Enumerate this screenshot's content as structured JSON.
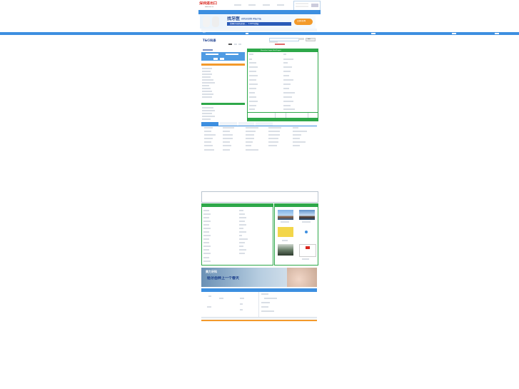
{
  "site": {
    "logo_cn": "深圳进出口",
    "logo_url": "www.szie.cn"
  },
  "top_banner": {
    "headline": "找牙医",
    "tagline": "就找身边放 牌医牙医",
    "subline": "去看牙就找这里 ， 100%的医",
    "cta": "立即咨询"
  },
  "nav": {
    "items": [
      "首页",
      "",
      "",
      "",
      "",
      "",
      "",
      ""
    ]
  },
  "company": {
    "logo_text": "T&Ci科泰",
    "sub": "科泰"
  },
  "search": {
    "button": "搜索"
  },
  "panel": {
    "title": "Shenzhen Import And Export",
    "left_tab": "",
    "right_tab": ""
  },
  "gallery": {
    "title": "",
    "left_title": ""
  },
  "bottom_banner": {
    "brand": "美力牙科",
    "slogan": "给牙齿种上一个春天"
  },
  "colors": {
    "nav_blue": "#3d8fe0",
    "accent_green": "#2ea84a",
    "orange": "#f39a2b",
    "red": "#d9251c"
  }
}
